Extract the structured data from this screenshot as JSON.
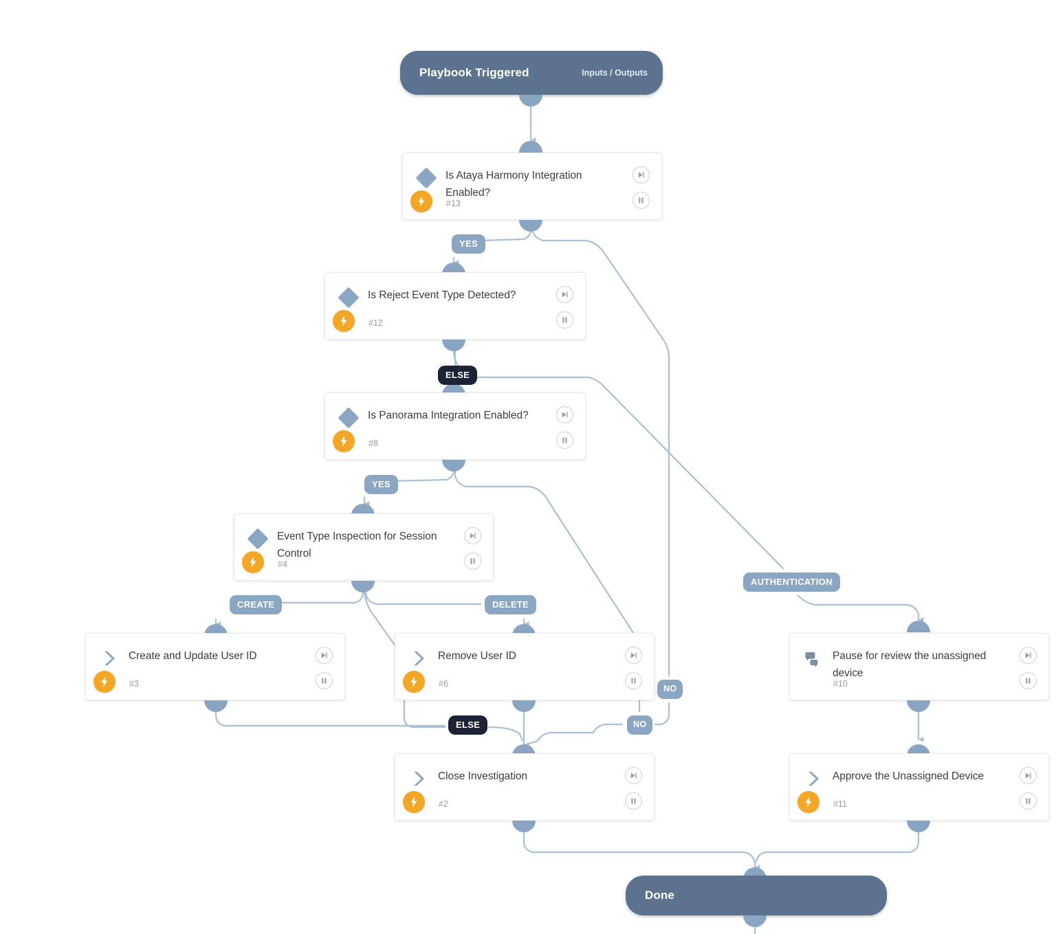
{
  "diagram": {
    "type": "playbook-workflow",
    "start": {
      "title": "Playbook Triggered",
      "subtitle": "Inputs / Outputs"
    },
    "end": {
      "title": "Done"
    },
    "nodes": [
      {
        "id": "13",
        "label": "Is Ataya Harmony Integration Enabled?",
        "number": "#13",
        "icon": "diamond-condition-icon",
        "has_bolt": true,
        "controls": [
          "skip-forward-icon",
          "pause-icon"
        ]
      },
      {
        "id": "12",
        "label": "Is Reject Event Type Detected?",
        "number": "#12",
        "icon": "diamond-condition-icon",
        "has_bolt": true,
        "controls": [
          "skip-forward-icon",
          "pause-icon"
        ]
      },
      {
        "id": "8",
        "label": "Is Panorama Integration Enabled?",
        "number": "#8",
        "icon": "diamond-condition-icon",
        "has_bolt": true,
        "controls": [
          "skip-forward-icon",
          "pause-icon"
        ]
      },
      {
        "id": "4",
        "label": "Event Type Inspection for Session Control",
        "number": "#4",
        "icon": "diamond-condition-icon",
        "has_bolt": true,
        "controls": [
          "skip-forward-icon",
          "pause-icon"
        ]
      },
      {
        "id": "3",
        "label": "Create and Update User ID",
        "number": "#3",
        "icon": "chevron-action-icon",
        "has_bolt": true,
        "controls": [
          "skip-forward-icon",
          "pause-icon"
        ]
      },
      {
        "id": "6",
        "label": "Remove User ID",
        "number": "#6",
        "icon": "chevron-action-icon",
        "has_bolt": true,
        "controls": [
          "skip-forward-icon",
          "pause-icon"
        ]
      },
      {
        "id": "10",
        "label": "Pause for review the unassigned device",
        "number": "#10",
        "icon": "chat-manual-icon",
        "has_bolt": false,
        "controls": [
          "skip-forward-icon",
          "pause-icon"
        ]
      },
      {
        "id": "2",
        "label": "Close Investigation",
        "number": "#2",
        "icon": "chevron-action-icon",
        "has_bolt": true,
        "controls": [
          "skip-forward-icon",
          "pause-icon"
        ]
      },
      {
        "id": "11",
        "label": "Approve the Unassigned Device",
        "number": "#11",
        "icon": "chevron-action-icon",
        "has_bolt": true,
        "controls": [
          "skip-forward-icon",
          "pause-icon"
        ]
      }
    ],
    "branch_labels": [
      {
        "id": "yes-13",
        "text": "YES",
        "style": "light"
      },
      {
        "id": "no-13",
        "text": "NO",
        "style": "light"
      },
      {
        "id": "else-12",
        "text": "ELSE",
        "style": "dark"
      },
      {
        "id": "auth-12",
        "text": "AUTHENTICATION",
        "style": "light"
      },
      {
        "id": "yes-8",
        "text": "YES",
        "style": "light"
      },
      {
        "id": "no-8",
        "text": "NO",
        "style": "light"
      },
      {
        "id": "create-4",
        "text": "CREATE",
        "style": "light"
      },
      {
        "id": "delete-4",
        "text": "DELETE",
        "style": "light"
      },
      {
        "id": "else-4",
        "text": "ELSE",
        "style": "dark"
      }
    ],
    "colors": {
      "terminal": "#5b738f",
      "edge": "#a9c0d6",
      "handle": "#8aa5c2",
      "pill_light": "#8ba6c2",
      "pill_dark": "#1c2334",
      "bolt": "#f3a724",
      "card_bg": "#ffffff",
      "title_text": "#3d3d3d",
      "number_text": "#9a9a9a"
    }
  }
}
